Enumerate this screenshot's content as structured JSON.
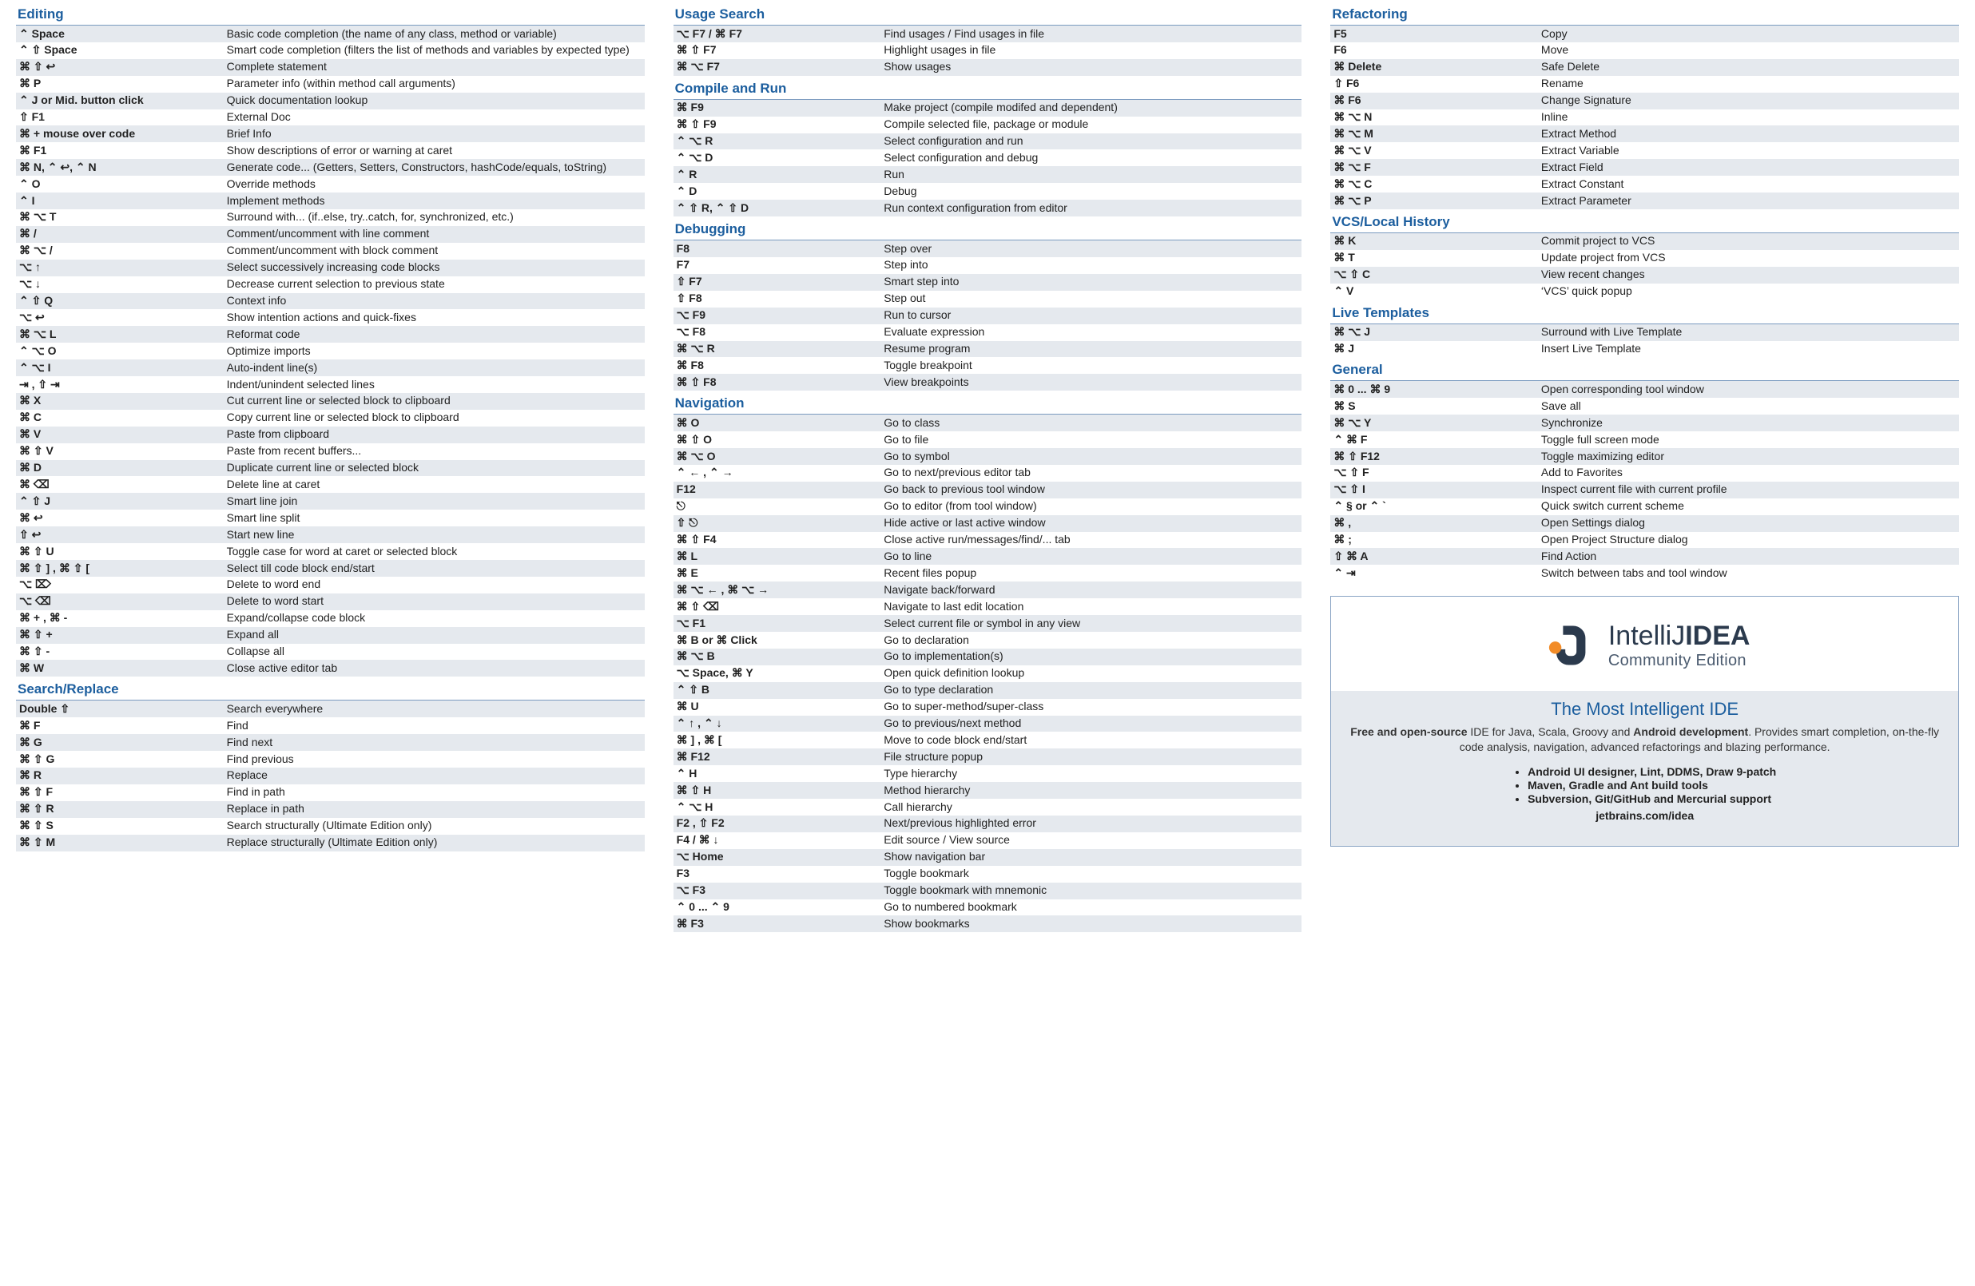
{
  "columns": [
    {
      "sections": [
        {
          "title": "Editing",
          "rows": [
            {
              "k": "⌃ Space",
              "d": "Basic code completion (the name of any class, method or variable)"
            },
            {
              "k": "⌃ ⇧ Space",
              "d": "Smart code completion (filters the list of methods and variables by expected type)"
            },
            {
              "k": "⌘ ⇧ ↩",
              "d": "Complete statement"
            },
            {
              "k": "⌘ P",
              "d": "Parameter info (within method call arguments)"
            },
            {
              "k": "⌃ J or Mid. button click",
              "d": "Quick documentation lookup"
            },
            {
              "k": "⇧ F1",
              "d": "External Doc"
            },
            {
              "k": "⌘ + mouse over code",
              "d": "Brief Info"
            },
            {
              "k": "⌘ F1",
              "d": "Show descriptions of error or warning at caret"
            },
            {
              "k": "⌘ N, ⌃ ↩, ⌃ N",
              "d": "Generate code... (Getters, Setters, Constructors, hashCode/equals, toString)"
            },
            {
              "k": "⌃ O",
              "d": "Override methods"
            },
            {
              "k": "⌃ I",
              "d": "Implement methods"
            },
            {
              "k": "⌘ ⌥ T",
              "d": "Surround with... (if..else, try..catch, for, synchronized, etc.)"
            },
            {
              "k": "⌘ /",
              "d": "Comment/uncomment with line comment"
            },
            {
              "k": "⌘ ⌥ /",
              "d": "Comment/uncomment with block comment"
            },
            {
              "k": "⌥ ↑",
              "d": "Select successively increasing code blocks"
            },
            {
              "k": "⌥ ↓",
              "d": "Decrease current selection to previous state"
            },
            {
              "k": "⌃ ⇧ Q",
              "d": "Context info"
            },
            {
              "k": "⌥ ↩",
              "d": "Show intention actions and quick-fixes"
            },
            {
              "k": "⌘ ⌥ L",
              "d": "Reformat code"
            },
            {
              "k": "⌃ ⌥ O",
              "d": "Optimize imports"
            },
            {
              "k": "⌃ ⌥ I",
              "d": "Auto-indent line(s)"
            },
            {
              "k": "⇥ , ⇧ ⇥",
              "d": "Indent/unindent selected lines"
            },
            {
              "k": "⌘ X",
              "d": "Cut current line or selected block to clipboard"
            },
            {
              "k": "⌘ C",
              "d": "Copy current line or selected block to clipboard"
            },
            {
              "k": "⌘ V",
              "d": "Paste from clipboard"
            },
            {
              "k": "⌘ ⇧ V",
              "d": "Paste from recent buffers..."
            },
            {
              "k": "⌘ D",
              "d": "Duplicate current line or selected block"
            },
            {
              "k": "⌘ ⌫",
              "d": "Delete line at caret"
            },
            {
              "k": "⌃ ⇧ J",
              "d": "Smart line join"
            },
            {
              "k": "⌘ ↩",
              "d": "Smart line split"
            },
            {
              "k": "⇧ ↩",
              "d": "Start new line"
            },
            {
              "k": "⌘ ⇧ U",
              "d": "Toggle case for word at caret or selected block"
            },
            {
              "k": "⌘ ⇧ ] , ⌘ ⇧ [",
              "d": "Select till code block end/start"
            },
            {
              "k": "⌥ ⌦",
              "d": "Delete to word end"
            },
            {
              "k": "⌥ ⌫",
              "d": "Delete to word start"
            },
            {
              "k": "⌘ + , ⌘ -",
              "d": "Expand/collapse code block"
            },
            {
              "k": "⌘ ⇧ +",
              "d": "Expand all"
            },
            {
              "k": "⌘ ⇧ -",
              "d": "Collapse all"
            },
            {
              "k": "⌘ W",
              "d": "Close active editor tab"
            }
          ]
        },
        {
          "title": "Search/Replace",
          "rows": [
            {
              "k": "Double ⇧",
              "d": "Search everywhere"
            },
            {
              "k": "⌘ F",
              "d": "Find"
            },
            {
              "k": "⌘ G",
              "d": "Find next"
            },
            {
              "k": "⌘ ⇧ G",
              "d": "Find previous"
            },
            {
              "k": "⌘ R",
              "d": "Replace"
            },
            {
              "k": "⌘ ⇧ F",
              "d": "Find in path"
            },
            {
              "k": "⌘ ⇧ R",
              "d": "Replace in path"
            },
            {
              "k": "⌘ ⇧ S",
              "d": "Search structurally (Ultimate Edition only)"
            },
            {
              "k": "⌘ ⇧ M",
              "d": "Replace structurally (Ultimate Edition only)"
            }
          ]
        }
      ]
    },
    {
      "sections": [
        {
          "title": "Usage Search",
          "rows": [
            {
              "k": "⌥ F7 / ⌘ F7",
              "d": "Find usages / Find usages in file"
            },
            {
              "k": "⌘ ⇧ F7",
              "d": "Highlight usages in file"
            },
            {
              "k": "⌘ ⌥ F7",
              "d": "Show usages"
            }
          ]
        },
        {
          "title": "Compile and Run",
          "rows": [
            {
              "k": "⌘ F9",
              "d": "Make project (compile modifed and dependent)"
            },
            {
              "k": "⌘ ⇧ F9",
              "d": "Compile selected file, package or module"
            },
            {
              "k": "⌃ ⌥ R",
              "d": "Select configuration and run"
            },
            {
              "k": "⌃ ⌥ D",
              "d": "Select configuration and debug"
            },
            {
              "k": "⌃ R",
              "d": "Run"
            },
            {
              "k": "⌃ D",
              "d": "Debug"
            },
            {
              "k": "⌃ ⇧ R, ⌃ ⇧ D",
              "d": "Run context configuration from editor"
            }
          ]
        },
        {
          "title": "Debugging",
          "rows": [
            {
              "k": "F8",
              "d": "Step over"
            },
            {
              "k": "F7",
              "d": "Step into"
            },
            {
              "k": "⇧ F7",
              "d": "Smart step into"
            },
            {
              "k": "⇧ F8",
              "d": "Step out"
            },
            {
              "k": "⌥ F9",
              "d": "Run to cursor"
            },
            {
              "k": "⌥ F8",
              "d": "Evaluate expression"
            },
            {
              "k": "⌘ ⌥ R",
              "d": "Resume program"
            },
            {
              "k": "⌘ F8",
              "d": "Toggle breakpoint"
            },
            {
              "k": "⌘ ⇧ F8",
              "d": "View breakpoints"
            }
          ]
        },
        {
          "title": "Navigation",
          "rows": [
            {
              "k": "⌘ O",
              "d": "Go to class"
            },
            {
              "k": "⌘ ⇧ O",
              "d": "Go to file"
            },
            {
              "k": "⌘ ⌥ O",
              "d": "Go to symbol"
            },
            {
              "k": "⌃ ← , ⌃ →",
              "d": "Go to next/previous editor tab"
            },
            {
              "k": "F12",
              "d": "Go back to previous tool window"
            },
            {
              "k": "⎋",
              "d": "Go to editor (from tool window)"
            },
            {
              "k": "⇧ ⎋",
              "d": "Hide active or last active window"
            },
            {
              "k": "⌘ ⇧ F4",
              "d": "Close active run/messages/find/... tab"
            },
            {
              "k": "⌘ L",
              "d": "Go to line"
            },
            {
              "k": "⌘ E",
              "d": "Recent files popup"
            },
            {
              "k": "⌘ ⌥ ← , ⌘ ⌥ →",
              "d": "Navigate back/forward"
            },
            {
              "k": "⌘ ⇧ ⌫",
              "d": "Navigate to last edit location"
            },
            {
              "k": "⌥ F1",
              "d": "Select current file or symbol in any view"
            },
            {
              "k": "⌘ B or ⌘ Click",
              "d": "Go to declaration"
            },
            {
              "k": "⌘ ⌥ B",
              "d": "Go to implementation(s)"
            },
            {
              "k": "⌥ Space, ⌘ Y",
              "d": "Open quick definition lookup"
            },
            {
              "k": "⌃ ⇧ B",
              "d": "Go to type declaration"
            },
            {
              "k": "⌘ U",
              "d": "Go to super-method/super-class"
            },
            {
              "k": "⌃ ↑ , ⌃ ↓",
              "d": "Go to previous/next method"
            },
            {
              "k": "⌘ ] , ⌘ [",
              "d": "Move to code block end/start"
            },
            {
              "k": "⌘ F12",
              "d": "File structure popup"
            },
            {
              "k": "⌃ H",
              "d": "Type hierarchy"
            },
            {
              "k": "⌘ ⇧ H",
              "d": "Method hierarchy"
            },
            {
              "k": "⌃ ⌥ H",
              "d": "Call hierarchy"
            },
            {
              "k": "F2 , ⇧ F2",
              "d": "Next/previous highlighted error"
            },
            {
              "k": "F4 / ⌘ ↓",
              "d": "Edit source / View source"
            },
            {
              "k": "⌥ Home",
              "d": "Show navigation bar"
            },
            {
              "k": "F3",
              "d": "Toggle bookmark"
            },
            {
              "k": "⌥ F3",
              "d": "Toggle bookmark with mnemonic"
            },
            {
              "k": "⌃ 0 ... ⌃ 9",
              "d": "Go to numbered bookmark"
            },
            {
              "k": "⌘ F3",
              "d": "Show bookmarks"
            }
          ]
        }
      ]
    },
    {
      "sections": [
        {
          "title": "Refactoring",
          "rows": [
            {
              "k": "F5",
              "d": "Copy"
            },
            {
              "k": "F6",
              "d": "Move"
            },
            {
              "k": "⌘ Delete",
              "d": "Safe Delete"
            },
            {
              "k": "⇧ F6",
              "d": "Rename"
            },
            {
              "k": "⌘ F6",
              "d": "Change Signature"
            },
            {
              "k": "⌘ ⌥ N",
              "d": "Inline"
            },
            {
              "k": "⌘ ⌥ M",
              "d": "Extract Method"
            },
            {
              "k": "⌘ ⌥ V",
              "d": "Extract Variable"
            },
            {
              "k": "⌘ ⌥ F",
              "d": "Extract Field"
            },
            {
              "k": "⌘ ⌥ C",
              "d": "Extract Constant"
            },
            {
              "k": "⌘ ⌥ P",
              "d": "Extract Parameter"
            }
          ]
        },
        {
          "title": "VCS/Local History",
          "rows": [
            {
              "k": "⌘ K",
              "d": "Commit project to VCS"
            },
            {
              "k": "⌘ T",
              "d": "Update project from VCS"
            },
            {
              "k": "⌥ ⇧ C",
              "d": "View recent changes"
            },
            {
              "k": "⌃ V",
              "d": "‘VCS’ quick popup"
            }
          ]
        },
        {
          "title": "Live Templates",
          "rows": [
            {
              "k": "⌘ ⌥ J",
              "d": "Surround with Live Template"
            },
            {
              "k": "⌘ J",
              "d": "Insert Live Template"
            }
          ]
        },
        {
          "title": "General",
          "rows": [
            {
              "k": "⌘ 0 ... ⌘ 9",
              "d": "Open corresponding tool window"
            },
            {
              "k": "⌘ S",
              "d": "Save all"
            },
            {
              "k": "⌘ ⌥ Y",
              "d": "Synchronize"
            },
            {
              "k": "⌃ ⌘ F",
              "d": "Toggle full screen mode"
            },
            {
              "k": "⌘ ⇧ F12",
              "d": "Toggle maximizing editor"
            },
            {
              "k": "⌥ ⇧ F",
              "d": "Add to Favorites"
            },
            {
              "k": "⌥ ⇧ I",
              "d": "Inspect current file with current profile"
            },
            {
              "k": "⌃ § or ⌃ `",
              "d": "Quick switch current scheme"
            },
            {
              "k": "⌘ ,",
              "d": "Open Settings dialog"
            },
            {
              "k": "⌘ ;",
              "d": "Open Project Structure dialog"
            },
            {
              "k": "⇧ ⌘ A",
              "d": "Find Action"
            },
            {
              "k": "⌃ ⇥",
              "d": "Switch between tabs and tool window"
            }
          ]
        }
      ]
    }
  ],
  "promo": {
    "name_light": "IntelliJ",
    "name_bold": "IDEA",
    "edition": "Community Edition",
    "headline": "The Most Intelligent IDE",
    "desc_parts": {
      "lead_bold": "Free and open-source",
      "lead_rest": " IDE for Java, Scala, Groovy and ",
      "bold2": "Android development",
      "rest2": ". Provides smart completion, on-the-fly code analysis, navigation, advanced refactorings and blazing performance."
    },
    "bullets": [
      "Android UI designer, Lint, DDMS, Draw 9-patch",
      "Maven, Gradle and Ant build tools",
      "Subversion, Git/GitHub and Mercurial support"
    ],
    "link": "jetbrains.com/idea"
  }
}
